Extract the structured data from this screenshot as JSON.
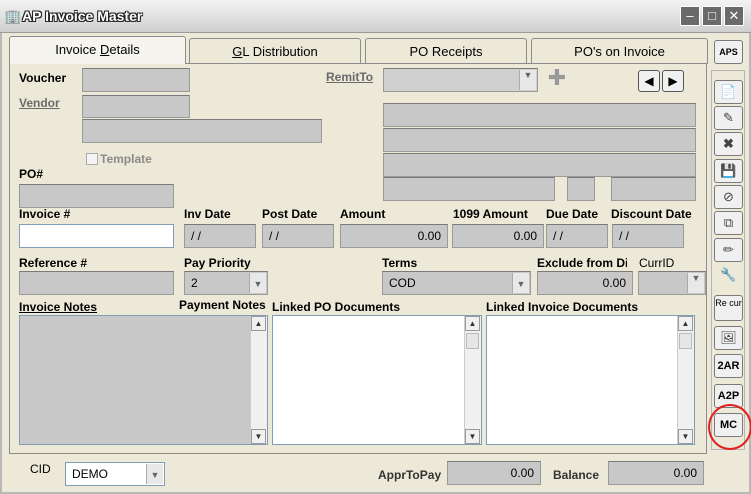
{
  "window": {
    "title": "AP Invoice Master",
    "icon": "building-icon"
  },
  "tabs": [
    {
      "label": "Invoice Details",
      "underline": "D",
      "active": true
    },
    {
      "label": "GL Distribution",
      "underline": "G",
      "active": false
    },
    {
      "label": "PO Receipts",
      "active": false
    },
    {
      "label": "PO's on Invoice",
      "active": false
    }
  ],
  "labels": {
    "voucher": "Voucher",
    "vendor": "Vendor",
    "remit_to": "RemitTo",
    "template": "Template",
    "po": "PO#",
    "invoice": "Invoice #",
    "inv_date": "Inv Date",
    "post_date": "Post Date",
    "amount": "Amount",
    "amount_1099": "1099 Amount",
    "due_date": "Due Date",
    "discount_date": "Discount Date",
    "reference": "Reference #",
    "pay_priority": "Pay Priority",
    "terms": "Terms",
    "exclude_from_di": "Exclude from Di",
    "curr_id": "CurrID",
    "invoice_notes": "Invoice Notes",
    "payment_notes": "Payment Notes",
    "linked_po_docs": "Linked PO Documents",
    "linked_invoice_docs": "Linked Invoice Documents",
    "cid": "CID",
    "appr_to_pay": "ApprToPay",
    "balance": "Balance"
  },
  "values": {
    "inv_date": "/ /",
    "post_date": "/ /",
    "amount": "0.00",
    "amount_1099": "0.00",
    "due_date": "/ /",
    "discount_date": "/ /",
    "pay_priority": "2",
    "terms": "COD",
    "exclude_from_di": "0.00",
    "cid": "DEMO",
    "appr_to_pay": "0.00",
    "balance": "0.00"
  },
  "sidebar": {
    "aps": "APS",
    "recur": "Re cur",
    "to_ar": "2AR",
    "a2p": "A2P",
    "mc": "MC"
  }
}
